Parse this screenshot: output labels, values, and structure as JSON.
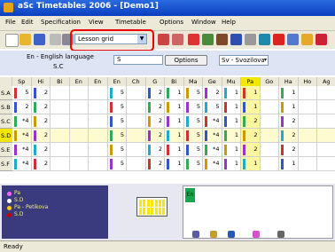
{
  "window": {
    "title": "aSc Timetables 2006  - [Demo1]"
  },
  "menu": [
    "File",
    "Edit",
    "Specification",
    "View",
    "Timetable",
    "Options",
    "Window",
    "Help"
  ],
  "toolbar": {
    "view_combo": "Lesson grid"
  },
  "options_bar": {
    "language_label": "En - English language",
    "selected_class": "S.C",
    "search_value": "S",
    "options_button": "Options",
    "teacher_select": "Sv - Svozilova"
  },
  "grid": {
    "columns": [
      "Sp",
      "Hi",
      "Bi",
      "En",
      "En",
      "En",
      "Ch",
      "G",
      "Bi",
      "Ma",
      "Ge",
      "Mu",
      "Pa",
      "Go",
      "Ha",
      "Ho",
      "Ag"
    ],
    "highlight_column": "Pa",
    "rows": [
      {
        "label": "S.A",
        "cells": [
          "5",
          "2",
          "",
          "",
          "",
          "5",
          "",
          "2",
          "1",
          "5",
          "2",
          "1",
          "1",
          "",
          "1",
          "",
          ""
        ]
      },
      {
        "label": "S.B",
        "cells": [
          "2",
          "2",
          "",
          "",
          "",
          "5",
          "",
          "2",
          "1",
          "5",
          "5",
          "1",
          "1",
          "",
          "1",
          "",
          ""
        ]
      },
      {
        "label": "S.C",
        "cells": [
          "*4",
          "2",
          "",
          "",
          "",
          "5",
          "",
          "2",
          "1",
          "5",
          "*4",
          "1",
          "2",
          "",
          "2",
          "",
          ""
        ]
      },
      {
        "label": "S.D",
        "cells": [
          "*4",
          "2",
          "",
          "",
          "",
          "5",
          "",
          "2",
          "1",
          "5",
          "*4",
          "1",
          "2",
          "",
          "2",
          "",
          ""
        ]
      },
      {
        "label": "S.E",
        "cells": [
          "*4",
          "2",
          "",
          "",
          "",
          "5",
          "",
          "2",
          "1",
          "5",
          "*4",
          "1",
          "2",
          "",
          "2",
          "",
          ""
        ]
      },
      {
        "label": "S.F",
        "cells": [
          "*4",
          "2",
          "",
          "",
          "",
          "5",
          "",
          "2",
          "1",
          "5",
          "*4",
          "1",
          "1",
          "",
          "1",
          "",
          ""
        ]
      }
    ],
    "selected_row": "S.D"
  },
  "card_panel": {
    "lines": [
      "Pa",
      "S.D",
      "Pa - Petikova",
      "S.D"
    ],
    "dot_colors": [
      "#ff66ff",
      "#ffffff",
      "#ffcc00",
      "#cc0000"
    ]
  },
  "lesson_tag": "En",
  "status": "Ready",
  "colors": {
    "title_bar": "#0a3fbf",
    "selected_row": "#f3e600",
    "highlight_box": "#e00000"
  }
}
